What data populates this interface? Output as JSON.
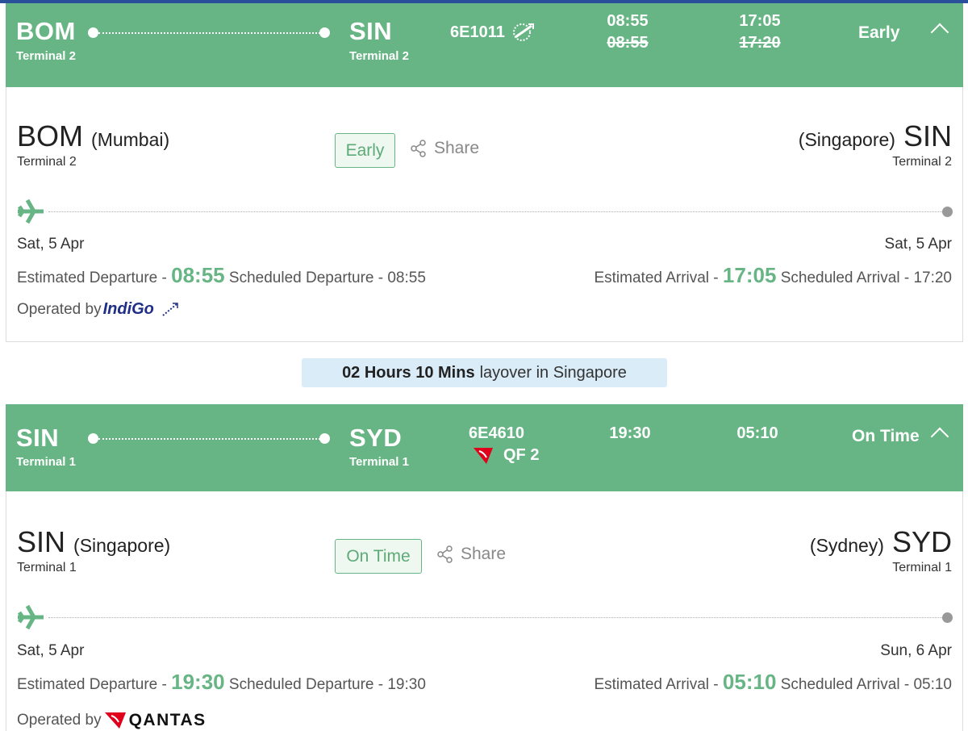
{
  "colors": {
    "header_green": "#67b584",
    "accent_green": "#67b584",
    "layover_bg": "#d9ecf7"
  },
  "layover": {
    "duration": "02 Hours 10 Mins",
    "text": "layover in Singapore"
  },
  "segments": [
    {
      "header": {
        "from_code": "BOM",
        "from_terminal": "Terminal 2",
        "to_code": "SIN",
        "to_terminal": "Terminal 2",
        "flight_no": "6E1011",
        "flight_icon": "indigo-logo-icon",
        "dep_est": "08:55",
        "dep_sched": "08:55",
        "arr_est": "17:05",
        "arr_sched": "17:20",
        "status": "Early"
      },
      "body": {
        "from_code": "BOM",
        "from_city": "(Mumbai)",
        "from_terminal": "Terminal 2",
        "to_code": "SIN",
        "to_city": "(Singapore)",
        "to_terminal": "Terminal 2",
        "status_badge": "Early",
        "share_label": "Share",
        "dep_date": "Sat, 5 Apr",
        "arr_date": "Sat, 5 Apr",
        "est_dep_label": "Estimated Departure -",
        "est_dep": "08:55",
        "sch_dep_label": "Scheduled Departure - 08:55",
        "est_arr_label": "Estimated Arrival -",
        "est_arr": "17:05",
        "sch_arr_label": "Scheduled Arrival - 17:20",
        "operated_label": "Operated by",
        "operator": "IndiGo"
      }
    },
    {
      "header": {
        "from_code": "SIN",
        "from_terminal": "Terminal 1",
        "to_code": "SYD",
        "to_terminal": "Terminal 1",
        "flight_no": "6E4610",
        "codeshare": "QF 2",
        "codeshare_icon": "qantas-logo-icon",
        "dep_est": "19:30",
        "arr_est": "05:10",
        "status": "On Time"
      },
      "body": {
        "from_code": "SIN",
        "from_city": "(Singapore)",
        "from_terminal": "Terminal 1",
        "to_code": "SYD",
        "to_city": "(Sydney)",
        "to_terminal": "Terminal 1",
        "status_badge": "On Time",
        "share_label": "Share",
        "dep_date": "Sat, 5 Apr",
        "arr_date": "Sun, 6 Apr",
        "est_dep_label": "Estimated Departure -",
        "est_dep": "19:30",
        "sch_dep_label": "Scheduled Departure - 19:30",
        "est_arr_label": "Estimated Arrival -",
        "est_arr": "05:10",
        "sch_arr_label": "Scheduled Arrival - 05:10",
        "operated_label": "Operated by",
        "operator": "QANTAS"
      }
    }
  ]
}
